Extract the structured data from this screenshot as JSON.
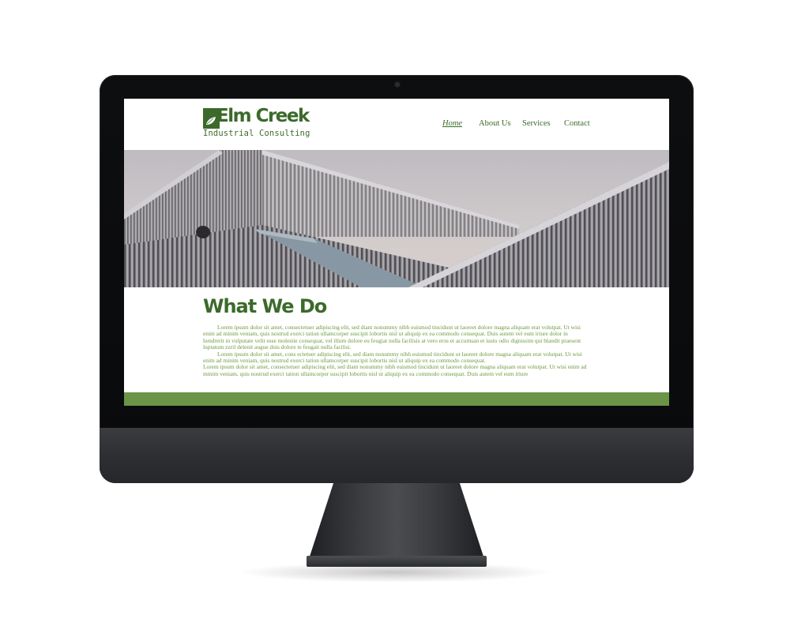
{
  "site": {
    "logo_name": "Elm Creek",
    "logo_tagline": "Industrial Consulting"
  },
  "nav": {
    "items": [
      {
        "label": "Home",
        "active": true
      },
      {
        "label": "About Us",
        "active": false
      },
      {
        "label": "Services",
        "active": false
      },
      {
        "label": "Contact",
        "active": false
      }
    ]
  },
  "section": {
    "title": "What We Do",
    "paragraphs": [
      "Lorem ipsum dolor sit amet, consectetuer adipiscing elit, sed diam nonummy nibh euismod tincidunt ut laoreet dolore magna aliquam erat volutpat. Ut wisi enim ad minim veniam, quis nostrud exerci tation ullamcorper suscipit lobortis nisl ut aliquip ex ea commodo consequat. Duis autem vel eum iriure dolor in hendrerit in vulputate velit esse molestie consequat, vel illum dolore eu feugiat nulla facilisis at vero eros et accumsan et iusto odio dignissim qui blandit praesent luptatum zzril delenit augue duis dolore te feugait nulla facilisi.",
      "Lorem ipsum dolor sit amet, cons ectetuer adipiscing elit, sed diam nonummy nibh euismod tincidunt ut laoreet dolore magna aliquam erat volutpat. Ut wisi enim ad minim veniam, quis nostrud exerci tation ullamcorper suscipit lobortis nisl ut aliquip ex ea commodo consequat.",
      "Lorem ipsum dolor sit amet, consectetuer adipiscing elit, sed diam nonummy nibh euismod tincidunt ut laoreet dolore magna aliquam erat volutpat. Ut wisi enim ad minim veniam, quis nostrud exerci tation ullamcorper suscipit lobortis nisl ut aliquip ex ea commodo consequat. Duis autem vel eum iriure"
    ]
  },
  "colors": {
    "brand_green": "#3b6a2a",
    "text_green": "#6b9a3e",
    "footer_green": "#6b9447"
  }
}
